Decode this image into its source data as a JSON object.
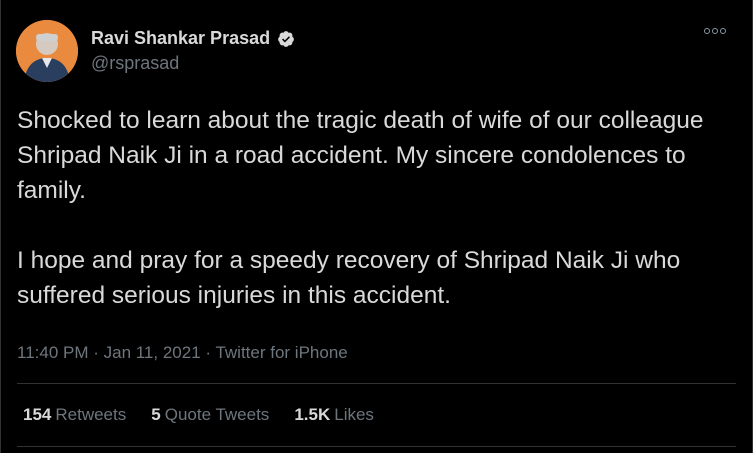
{
  "author": {
    "name": "Ravi Shankar Prasad",
    "handle": "@rsprasad",
    "verified_icon": "verified-badge-icon"
  },
  "tweet": {
    "paragraphs": [
      "Shocked to learn about the tragic death of wife of our colleague Shripad Naik Ji in a road accident. My sincere condolences to family.",
      "I hope and pray for a speedy recovery of Shripad Naik Ji who suffered serious injuries in this accident."
    ]
  },
  "meta": {
    "text": "11:40 PM · Jan 11, 2021 · Twitter for iPhone"
  },
  "stats": {
    "retweets_count": "154",
    "retweets_label": "Retweets",
    "quotes_count": "5",
    "quotes_label": "Quote Tweets",
    "likes_count": "1.5K",
    "likes_label": "Likes"
  },
  "colors": {
    "background": "#000000",
    "text": "#d9d9d9",
    "secondary": "#6e767d"
  }
}
